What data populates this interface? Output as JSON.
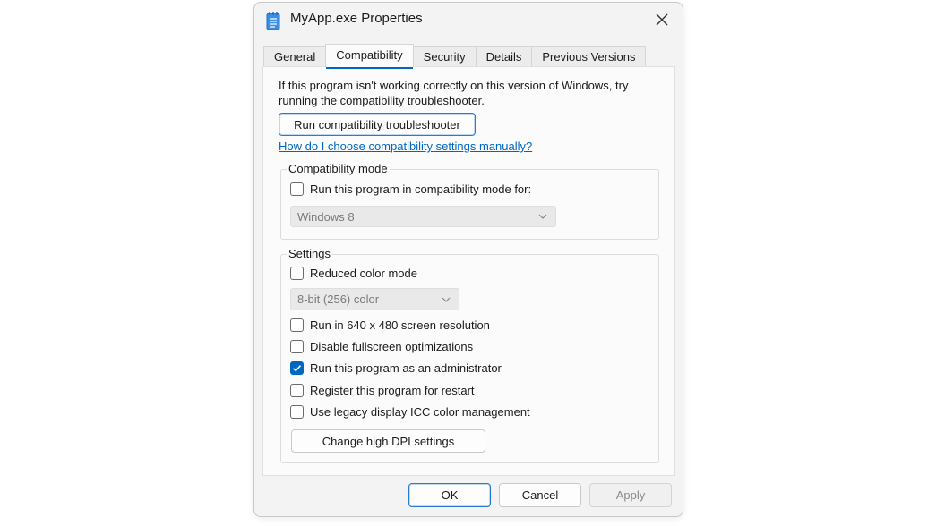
{
  "window": {
    "title": "MyApp.exe Properties",
    "app_icon": "notepad-app-icon",
    "close_icon": "close-icon"
  },
  "tabs": [
    {
      "label": "General",
      "active": false
    },
    {
      "label": "Compatibility",
      "active": true
    },
    {
      "label": "Security",
      "active": false
    },
    {
      "label": "Details",
      "active": false
    },
    {
      "label": "Previous Versions",
      "active": false
    }
  ],
  "compat": {
    "intro": "If this program isn't working correctly on this version of Windows, try running the compatibility troubleshooter.",
    "troubleshooter_button": "Run compatibility troubleshooter",
    "help_link": "How do I choose compatibility settings manually?"
  },
  "compat_mode": {
    "group_label": "Compatibility mode",
    "checkbox_label": "Run this program in compatibility mode for:",
    "checked": false,
    "os_select_value": "Windows 8"
  },
  "settings": {
    "group_label": "Settings",
    "reduced_color": {
      "label": "Reduced color mode",
      "checked": false
    },
    "color_select_value": "8-bit (256) color",
    "res_640": {
      "label": "Run in 640 x 480 screen resolution",
      "checked": false
    },
    "fullscreen_opt": {
      "label": "Disable fullscreen optimizations",
      "checked": false
    },
    "run_admin": {
      "label": "Run this program as an administrator",
      "checked": true
    },
    "register_restart": {
      "label": "Register this program for restart",
      "checked": false
    },
    "legacy_icc": {
      "label": "Use legacy display ICC color management",
      "checked": false
    },
    "dpi_button": "Change high DPI settings"
  },
  "footer": {
    "ok": "OK",
    "cancel": "Cancel",
    "apply": "Apply"
  },
  "colors": {
    "accent": "#0067c0",
    "link": "#0067c0"
  }
}
